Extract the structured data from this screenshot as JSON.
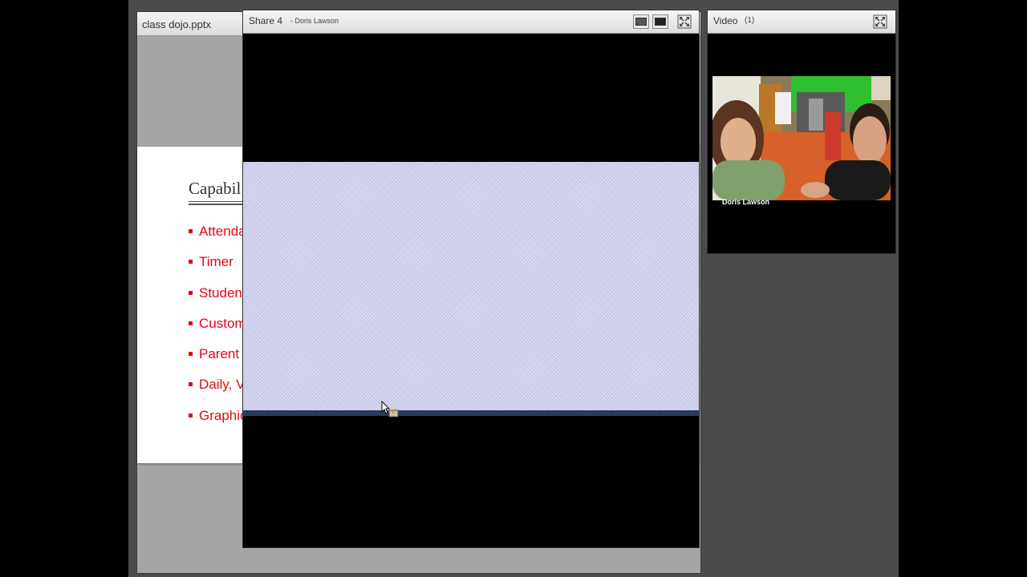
{
  "pptx_pod": {
    "title": "class dojo.pptx",
    "slide": {
      "heading": "Capabil",
      "bullets": [
        "Attenda",
        "Timer",
        "Student",
        "Custom",
        "Parent",
        "Daily, V",
        "Graphic"
      ]
    }
  },
  "share_pod": {
    "title": "Share 4",
    "presenter": "- Doris Lawson"
  },
  "video_pod": {
    "title": "Video",
    "count": "(1)",
    "participant_name": "Doris Lawson"
  },
  "colors": {
    "bullet_text": "#e30613",
    "background": "#000000",
    "stage": "#4b4b4b",
    "shared_screen": "#dcdcf0"
  }
}
